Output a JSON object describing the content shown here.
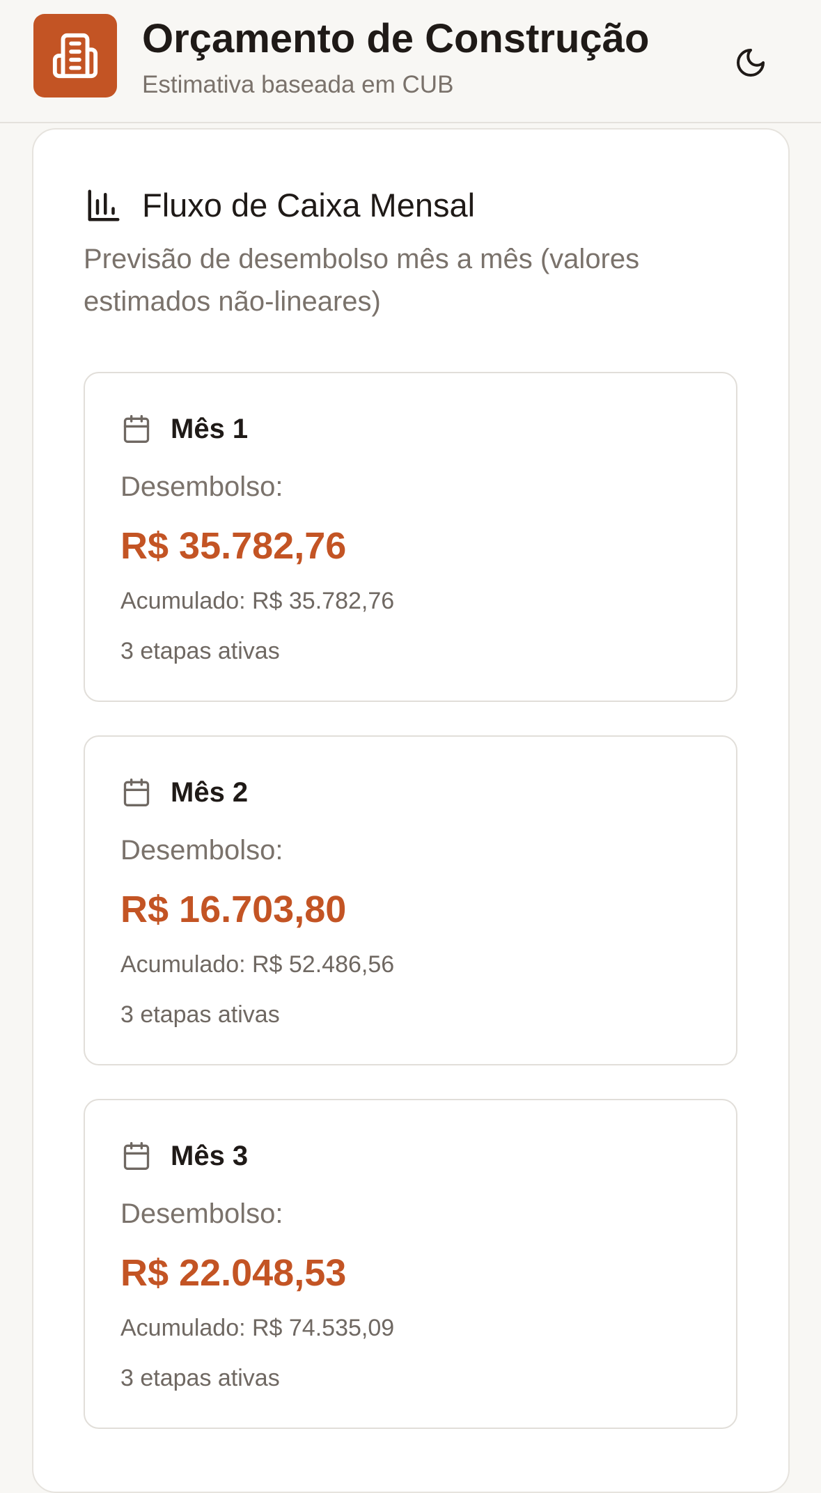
{
  "header": {
    "title": "Orçamento de Construção",
    "subtitle": "Estimativa baseada em CUB",
    "logo_icon": "building-icon",
    "theme_icon": "moon-icon"
  },
  "section": {
    "icon": "bar-chart-icon",
    "title": "Fluxo de Caixa Mensal",
    "description": "Previsão de desembolso mês a mês (valores estimados não-lineares)"
  },
  "months": [
    {
      "label": "Mês 1",
      "disbursement_label": "Desembolso:",
      "disbursement": "R$ 35.782,76",
      "accumulated": "Acumulado: R$ 35.782,76",
      "stages": "3 etapas ativas"
    },
    {
      "label": "Mês 2",
      "disbursement_label": "Desembolso:",
      "disbursement": "R$ 16.703,80",
      "accumulated": "Acumulado: R$ 52.486,56",
      "stages": "3 etapas ativas"
    },
    {
      "label": "Mês 3",
      "disbursement_label": "Desembolso:",
      "disbursement": "R$ 22.048,53",
      "accumulated": "Acumulado: R$ 74.535,09",
      "stages": "3 etapas ativas"
    }
  ],
  "colors": {
    "accent": "#c35424",
    "background": "#f8f7f4",
    "card": "#ffffff",
    "text": "#1f1a17",
    "muted": "#7a726b"
  }
}
